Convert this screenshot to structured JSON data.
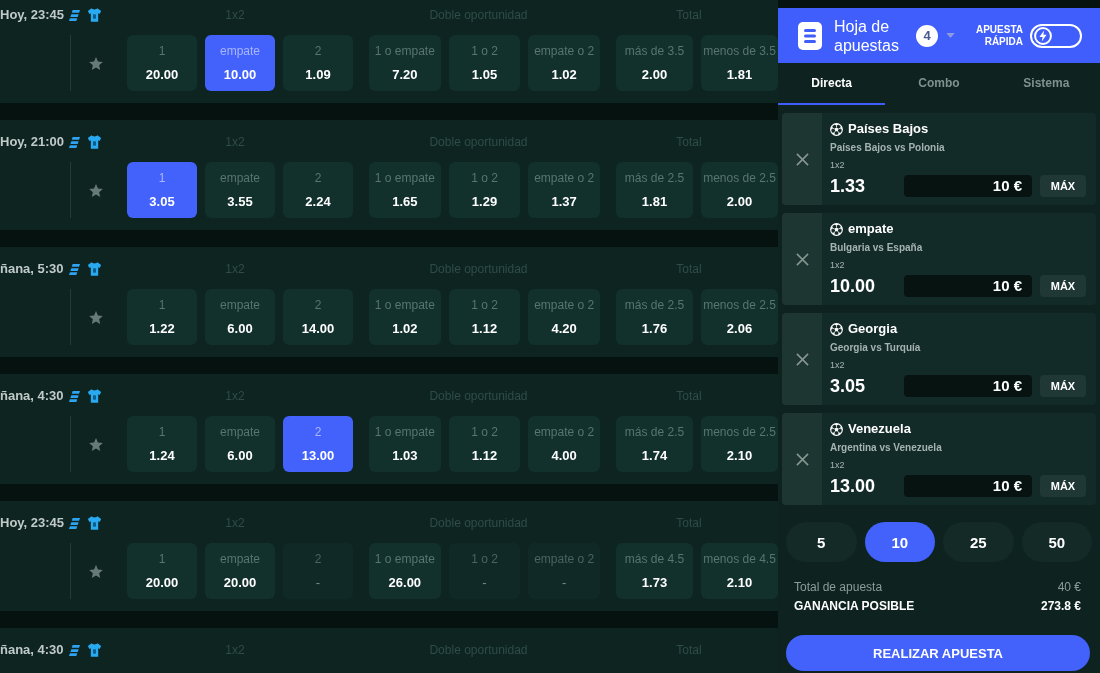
{
  "matches": [
    {
      "time": "Hoy, 23:45",
      "markets": [
        {
          "title": "1x2",
          "odds": [
            {
              "label": "1",
              "value": "20.00",
              "selected": false,
              "disabled": false
            },
            {
              "label": "empate",
              "value": "10.00",
              "selected": true,
              "disabled": false
            },
            {
              "label": "2",
              "value": "1.09",
              "selected": false,
              "disabled": false
            }
          ]
        },
        {
          "title": "Doble oportunidad",
          "odds": [
            {
              "label": "1 o empate",
              "value": "7.20",
              "selected": false,
              "disabled": false
            },
            {
              "label": "1 o 2",
              "value": "1.05",
              "selected": false,
              "disabled": false
            },
            {
              "label": "empate o 2",
              "value": "1.02",
              "selected": false,
              "disabled": false
            }
          ]
        },
        {
          "title": "Total",
          "odds": [
            {
              "label": "más de 3.5",
              "value": "2.00",
              "selected": false,
              "disabled": false
            },
            {
              "label": "menos de 3.5",
              "value": "1.81",
              "selected": false,
              "disabled": false
            }
          ]
        }
      ]
    },
    {
      "time": "Hoy, 21:00",
      "markets": [
        {
          "title": "1x2",
          "odds": [
            {
              "label": "1",
              "value": "3.05",
              "selected": true,
              "disabled": false
            },
            {
              "label": "empate",
              "value": "3.55",
              "selected": false,
              "disabled": false
            },
            {
              "label": "2",
              "value": "2.24",
              "selected": false,
              "disabled": false
            }
          ]
        },
        {
          "title": "Doble oportunidad",
          "odds": [
            {
              "label": "1 o empate",
              "value": "1.65",
              "selected": false,
              "disabled": false
            },
            {
              "label": "1 o 2",
              "value": "1.29",
              "selected": false,
              "disabled": false
            },
            {
              "label": "empate o 2",
              "value": "1.37",
              "selected": false,
              "disabled": false
            }
          ]
        },
        {
          "title": "Total",
          "odds": [
            {
              "label": "más de 2.5",
              "value": "1.81",
              "selected": false,
              "disabled": false
            },
            {
              "label": "menos de 2.5",
              "value": "2.00",
              "selected": false,
              "disabled": false
            }
          ]
        }
      ]
    },
    {
      "time": "ñana, 5:30",
      "markets": [
        {
          "title": "1x2",
          "odds": [
            {
              "label": "1",
              "value": "1.22",
              "selected": false,
              "disabled": false
            },
            {
              "label": "empate",
              "value": "6.00",
              "selected": false,
              "disabled": false
            },
            {
              "label": "2",
              "value": "14.00",
              "selected": false,
              "disabled": false
            }
          ]
        },
        {
          "title": "Doble oportunidad",
          "odds": [
            {
              "label": "1 o empate",
              "value": "1.02",
              "selected": false,
              "disabled": false
            },
            {
              "label": "1 o 2",
              "value": "1.12",
              "selected": false,
              "disabled": false
            },
            {
              "label": "empate o 2",
              "value": "4.20",
              "selected": false,
              "disabled": false
            }
          ]
        },
        {
          "title": "Total",
          "odds": [
            {
              "label": "más de 2.5",
              "value": "1.76",
              "selected": false,
              "disabled": false
            },
            {
              "label": "menos de 2.5",
              "value": "2.06",
              "selected": false,
              "disabled": false
            }
          ]
        }
      ]
    },
    {
      "time": "ñana, 4:30",
      "markets": [
        {
          "title": "1x2",
          "odds": [
            {
              "label": "1",
              "value": "1.24",
              "selected": false,
              "disabled": false
            },
            {
              "label": "empate",
              "value": "6.00",
              "selected": false,
              "disabled": false
            },
            {
              "label": "2",
              "value": "13.00",
              "selected": true,
              "disabled": false
            }
          ]
        },
        {
          "title": "Doble oportunidad",
          "odds": [
            {
              "label": "1 o empate",
              "value": "1.03",
              "selected": false,
              "disabled": false
            },
            {
              "label": "1 o 2",
              "value": "1.12",
              "selected": false,
              "disabled": false
            },
            {
              "label": "empate o 2",
              "value": "4.00",
              "selected": false,
              "disabled": false
            }
          ]
        },
        {
          "title": "Total",
          "odds": [
            {
              "label": "más de 2.5",
              "value": "1.74",
              "selected": false,
              "disabled": false
            },
            {
              "label": "menos de 2.5",
              "value": "2.10",
              "selected": false,
              "disabled": false
            }
          ]
        }
      ]
    },
    {
      "time": "Hoy, 23:45",
      "markets": [
        {
          "title": "1x2",
          "odds": [
            {
              "label": "1",
              "value": "20.00",
              "selected": false,
              "disabled": false
            },
            {
              "label": "empate",
              "value": "20.00",
              "selected": false,
              "disabled": false
            },
            {
              "label": "2",
              "value": "-",
              "selected": false,
              "disabled": true
            }
          ]
        },
        {
          "title": "Doble oportunidad",
          "odds": [
            {
              "label": "1 o empate",
              "value": "26.00",
              "selected": false,
              "disabled": false
            },
            {
              "label": "1 o 2",
              "value": "-",
              "selected": false,
              "disabled": true
            },
            {
              "label": "empate o 2",
              "value": "-",
              "selected": false,
              "disabled": true
            }
          ]
        },
        {
          "title": "Total",
          "odds": [
            {
              "label": "más de 4.5",
              "value": "1.73",
              "selected": false,
              "disabled": false
            },
            {
              "label": "menos de 4.5",
              "value": "2.10",
              "selected": false,
              "disabled": false
            }
          ]
        }
      ]
    },
    {
      "time": "ñana, 4:30",
      "markets": [
        {
          "title": "1x2"
        },
        {
          "title": "Doble oportunidad"
        },
        {
          "title": "Total"
        }
      ]
    }
  ],
  "betslip": {
    "title": "Hoja de apuestas",
    "count": "4",
    "quick_bet": {
      "label": "APUESTA RÁPIDA",
      "on": false
    },
    "tabs": [
      {
        "label": "Directa",
        "selected": true
      },
      {
        "label": "Combo",
        "selected": false
      },
      {
        "label": "Sistema",
        "selected": false
      }
    ],
    "bets": [
      {
        "selection": "Países Bajos",
        "match": "Países Bajos vs Polonia",
        "market": "1x2",
        "odds": "1.33",
        "stake": "10 €",
        "max_label": "MÁX"
      },
      {
        "selection": "empate",
        "match": "Bulgaria vs España",
        "market": "1x2",
        "odds": "10.00",
        "stake": "10 €",
        "max_label": "MÁX"
      },
      {
        "selection": "Georgia",
        "match": "Georgia vs Turquía",
        "market": "1x2",
        "odds": "3.05",
        "stake": "10 €",
        "max_label": "MÁX"
      },
      {
        "selection": "Venezuela",
        "match": "Argentina vs Venezuela",
        "market": "1x2",
        "odds": "13.00",
        "stake": "10 €",
        "max_label": "MÁX"
      }
    ],
    "quick_stakes": [
      {
        "label": "5",
        "selected": false
      },
      {
        "label": "10",
        "selected": true
      },
      {
        "label": "25",
        "selected": false
      },
      {
        "label": "50",
        "selected": false
      }
    ],
    "total_label": "Total de apuesta",
    "total": "40 €",
    "winnings_label": "GANANCIA POSIBLE",
    "winnings": "273.8 €",
    "submit": "REALIZAR APUESTA"
  }
}
